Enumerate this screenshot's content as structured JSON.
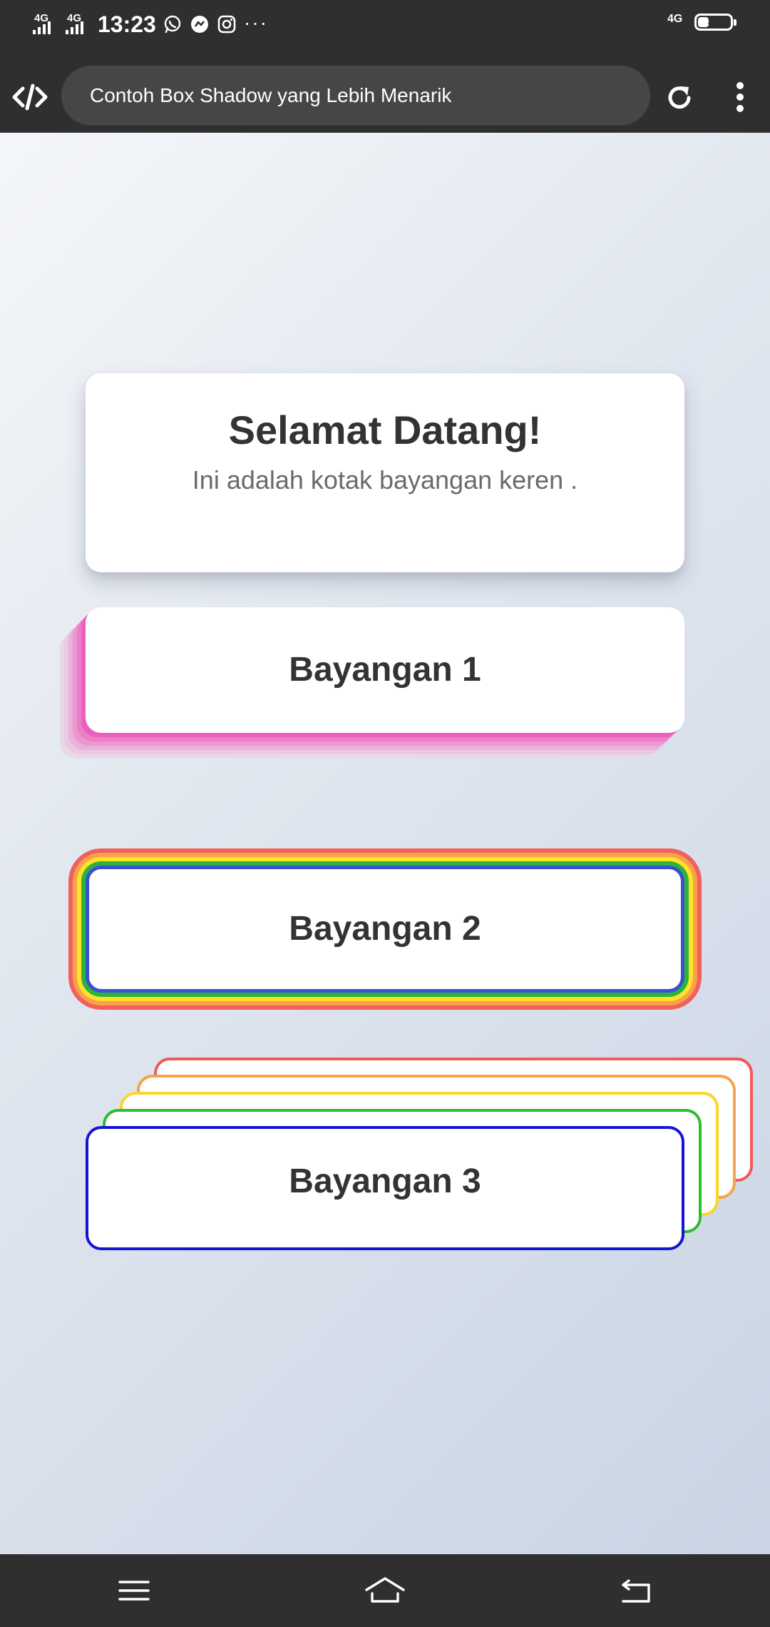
{
  "status_bar": {
    "signal_1_label": "4G",
    "signal_2_label": "4G",
    "time": "13:23",
    "more_indicator": "···",
    "network_label": "4G",
    "battery_percent": "32",
    "battery_level": 0.32,
    "icons": [
      "whatsapp-icon",
      "messenger-icon",
      "instagram-icon"
    ]
  },
  "app_bar": {
    "page_title": "Contoh Box Shadow yang Lebih Menarik",
    "icons": [
      "code-logo-icon",
      "reload-icon",
      "more-vertical-icon"
    ]
  },
  "page": {
    "welcome_title": "Selamat Datang!",
    "welcome_subtitle": "Ini adalah kotak bayangan keren .",
    "boxes": [
      {
        "label": "Bayangan 1"
      },
      {
        "label": "Bayangan 2"
      },
      {
        "label": "Bayangan 3"
      }
    ]
  },
  "colors": {
    "background_start": "#f4f6f9",
    "background_end": "#c9d4e4",
    "bar_background": "#2f2f2f",
    "pink_shadow": "#ec5fbf",
    "rainbow": [
      "#3a4fd6",
      "#2cb43a",
      "#ffe12a",
      "#f7a24b",
      "#f0605c"
    ],
    "stack_border": "#1414d6"
  },
  "nav_bar": {
    "icons": [
      "menu-icon",
      "home-icon",
      "back-icon"
    ]
  }
}
